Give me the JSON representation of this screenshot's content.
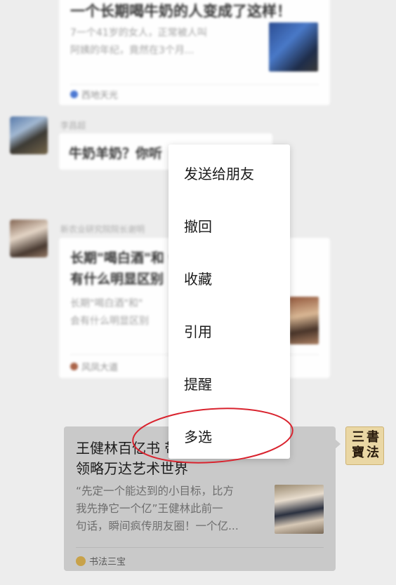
{
  "top_card": {
    "title": "一个长期喝牛奶的人变成了这样！",
    "desc": "7一个41岁的女人，正常被人叫\n阿姨的年纪，竟然在3个月...",
    "source": "西地天光"
  },
  "message_1": {
    "sender": "李昌超",
    "text": "牛奶羊奶？你听"
  },
  "message_2": {
    "sender": "新农业研究院院长谢明",
    "title": "长期\"喝白酒\"和                会\n有什么明显区别",
    "desc": "长期\"喝白酒\"和\"\n会有什么明显区别",
    "source": "风凤大道"
  },
  "context_menu": {
    "items": [
      "发送给朋友",
      "撤回",
      "收藏",
      "引用",
      "提醒",
      "多选"
    ]
  },
  "own_message": {
    "title": "王健林百亿书                    带你\n领略万达艺术世界",
    "desc": "“先定一个能达到的小目标，比方\n我先挣它一个亿”王健林此前一\n句话，瞬间疯传朋友圈！一个亿...",
    "source": "书法三宝",
    "avatar_chars": [
      "三",
      "書",
      "寶",
      "法"
    ]
  },
  "colors": {
    "background": "#ededed",
    "highlight_ring": "#d9232e"
  }
}
